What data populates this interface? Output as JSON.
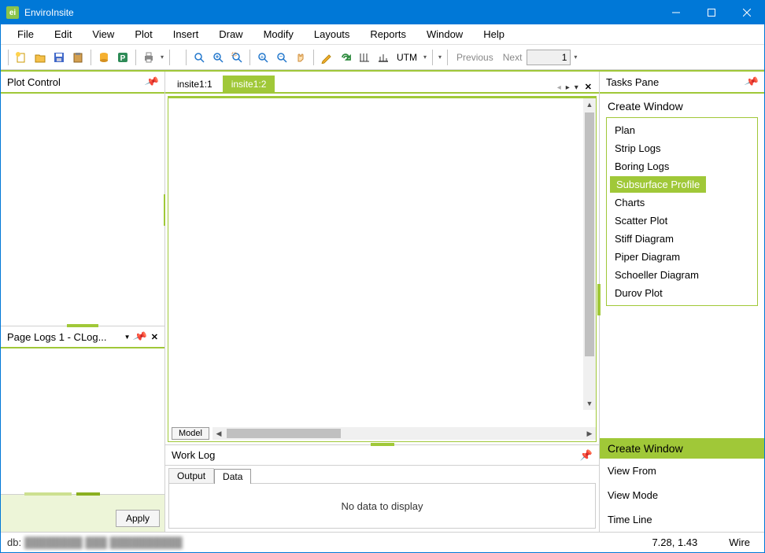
{
  "app": {
    "title": "EnviroInsite"
  },
  "menu": [
    "File",
    "Edit",
    "View",
    "Plot",
    "Insert",
    "Draw",
    "Modify",
    "Layouts",
    "Reports",
    "Window",
    "Help"
  ],
  "toolbar": {
    "utm_label": "UTM",
    "prev_label": "Previous",
    "next_label": "Next",
    "page_value": "1"
  },
  "left": {
    "plot_control": {
      "title": "Plot Control"
    },
    "page_logs": {
      "title": "Page Logs 1 - CLog...",
      "apply_label": "Apply"
    }
  },
  "center": {
    "tabs": [
      "insite1:1",
      "insite1:2"
    ],
    "active_tab": 1,
    "model_tab": "Model",
    "work_log": {
      "title": "Work Log",
      "tabs": [
        "Output",
        "Data"
      ],
      "active_tab": 1,
      "empty_text": "No data to display"
    }
  },
  "right": {
    "title": "Tasks Pane",
    "create_window_title": "Create Window",
    "items": [
      "Plan",
      "Strip Logs",
      "Boring Logs",
      "Subsurface Profile",
      "Charts",
      "Scatter Plot",
      "Stiff Diagram",
      "Piper Diagram",
      "Schoeller Diagram",
      "Durov Plot"
    ],
    "selected_index": 3,
    "bottom_bar": "Create Window",
    "bottom_items": [
      "View From",
      "View Mode",
      "Time Line"
    ]
  },
  "status": {
    "db_label": "db:",
    "coords": "7.28, 1.43",
    "mode": "Wire"
  }
}
